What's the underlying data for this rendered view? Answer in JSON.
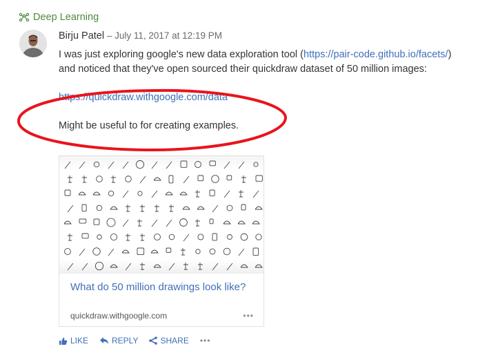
{
  "group": {
    "name": "Deep Learning",
    "icon": "group-network-icon"
  },
  "post": {
    "author": "Birju Patel",
    "separator": " – ",
    "timestamp": "July 11, 2017 at 12:19 PM",
    "paragraph1_start": "I was just exploring google's new data exploration tool (",
    "paragraph1_link": "https://pair-code.github.io/facets/",
    "paragraph1_end": ") and noticed that they've open sourced their quickdraw dataset of 50 million images:",
    "data_link": "https://quickdraw.withgoogle.com/data",
    "closing_text": "Might be useful to for creating examples."
  },
  "annotation": {
    "shape": "ellipse",
    "color": "#e8141c"
  },
  "link_preview": {
    "image_alt": "grid of quickdraw doodles",
    "title": "What do 50 million drawings look like?",
    "source": "quickdraw.withgoogle.com",
    "more_label": "•••"
  },
  "actions": {
    "like": "LIKE",
    "reply": "REPLY",
    "share": "SHARE",
    "more": "•••"
  },
  "colors": {
    "link": "#3f6fb7",
    "group": "#4e8a3e",
    "annotation": "#e8141c"
  }
}
